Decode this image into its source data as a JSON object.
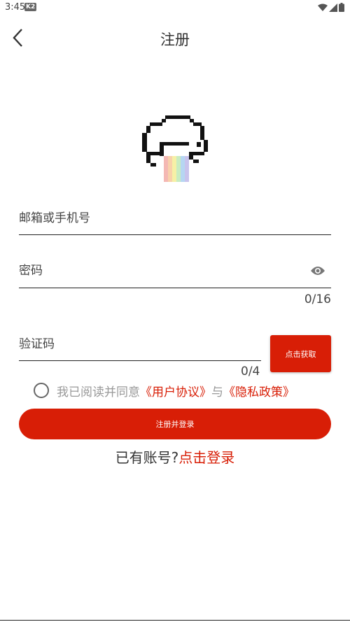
{
  "status_bar": {
    "time": "3:45",
    "k2_badge": "K2"
  },
  "header": {
    "title": "注册"
  },
  "form": {
    "email_placeholder": "邮箱或手机号",
    "password_placeholder": "密码",
    "password_counter": "0/16",
    "code_placeholder": "验证码",
    "code_counter": "0/4",
    "get_code_label": "点击获取"
  },
  "agreement": {
    "prefix": "我已阅读并同意",
    "user_agreement": "《用户协议》",
    "conjunction": "与",
    "privacy_policy": "《隐私政策》"
  },
  "actions": {
    "register_label": "注册并登录",
    "have_account": "已有账号?",
    "login_link": "点击登录"
  },
  "colors": {
    "accent": "#d81e06",
    "text": "#333333",
    "muted": "#999999"
  }
}
